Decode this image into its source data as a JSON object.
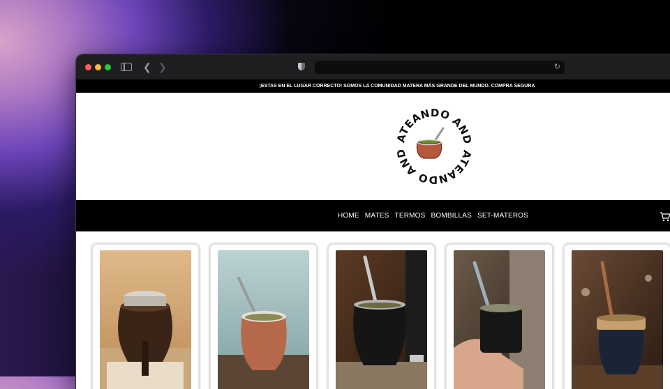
{
  "announcement": "¡ESTAS EN EL LUGAR CORRECTO! SOMOS LA COMUNIDAD MATERA MÁS GRANDE DEL MUNDO. COMPRA SEGURA",
  "logo": {
    "text_top": "MATEANDO ANDO",
    "text_bottom": "MATEANDO ANDO"
  },
  "nav": {
    "items": [
      "HOME",
      "MATES",
      "TERMOS",
      "BOMBILLAS",
      "SET-MATEROS"
    ]
  },
  "icons": {
    "sidebar": "sidebar-icon",
    "back": "chevron-left-icon",
    "forward": "chevron-right-icon",
    "shield": "shield-icon",
    "reload": "reload-icon",
    "cart": "cart-icon"
  },
  "products": [
    {
      "name": "mate-imperial-black",
      "scene": "wheat field"
    },
    {
      "name": "mate-clay",
      "scene": "sea"
    },
    {
      "name": "mate-black-with-thermos",
      "scene": "forest"
    },
    {
      "name": "mate-black-in-hand",
      "scene": "outdoor"
    },
    {
      "name": "mate-imperial-blue",
      "scene": "forest"
    }
  ],
  "colors": {
    "announcement_bg": "#000000",
    "nav_bg": "#000000",
    "mate_terracotta": "#b5583b"
  }
}
